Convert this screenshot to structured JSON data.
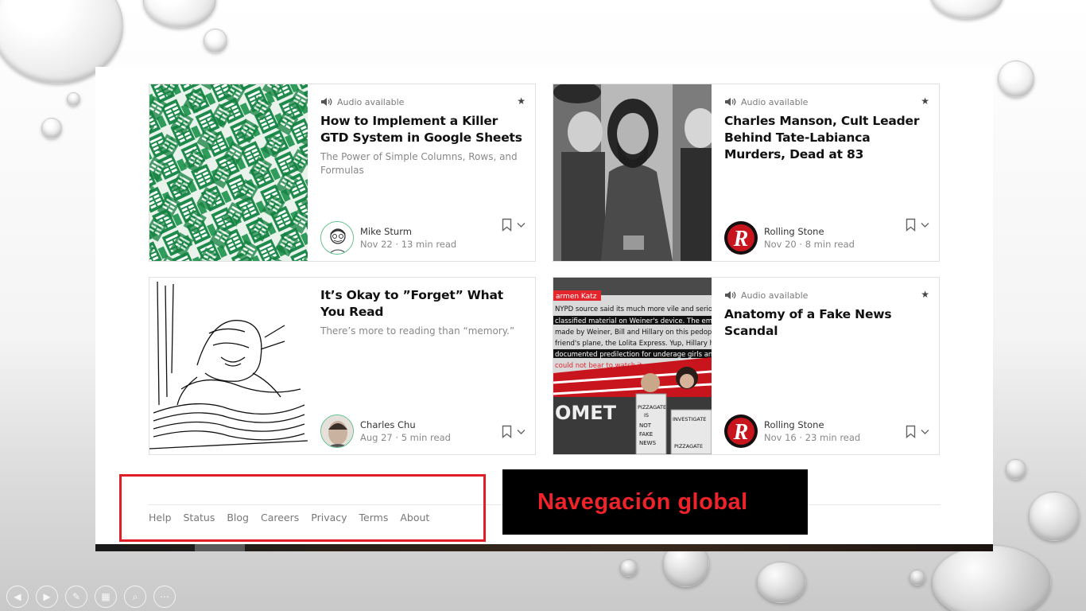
{
  "cards": [
    {
      "audio": "Audio available",
      "title": "How to Implement a Killer GTD System in Google Sheets",
      "subtitle": "The Power of Simple Columns, Rows, and Formulas",
      "author": "Mike Sturm",
      "meta": "Nov 22 · 13 min read"
    },
    {
      "audio": "Audio available",
      "title": "Charles Manson, Cult Leader Behind Tate-Labianca Murders, Dead at 83",
      "subtitle": "",
      "author": "Rolling Stone",
      "meta": "Nov 20 · 8 min read"
    },
    {
      "audio": "",
      "title": "It’s Okay to ”Forget” What You Read",
      "subtitle": "There’s more to reading than “memory.”",
      "author": "Charles Chu",
      "meta": "Aug 27 · 5 min read"
    },
    {
      "audio": "Audio available",
      "title": "Anatomy of a Fake News Scandal",
      "subtitle": "",
      "author": "Rolling Stone",
      "meta": "Nov 16 · 23 min read"
    }
  ],
  "rs_logo_letter": "R",
  "footer": {
    "links": [
      "Help",
      "Status",
      "Blog",
      "Careers",
      "Privacy",
      "Terms",
      "About"
    ]
  },
  "annotation_label": "Navegación global",
  "colors": {
    "highlight": "#e11e26",
    "label_bg": "#000000",
    "label_text": "#f0222a",
    "avatar_ring": "#5cbf8a"
  },
  "news_image_text": {
    "header": "armen Katz",
    "lines": [
      "NYPD source said its much more vile and serious",
      "classified material on Weiner's device. The email DETAIL",
      "made by Weiner, Bill and Hillary on this pedophile isla",
      "friend's plane, the Lolita Express. Yup, Hillary has a wo",
      "documented predilection for underage girls and br",
      "could not bear to watch it"
    ],
    "sign1": "PIZZAGATE IS NOT FAKE NEWS",
    "sign2": "INVESTIGATE PIZZAGATE",
    "banner": "OMET"
  },
  "icons": {
    "audio": "speaker-icon",
    "featured": "star-icon",
    "save": "bookmark-icon",
    "more": "chevron-down-icon",
    "ppt_controls": [
      "prev-icon",
      "next-icon",
      "pen-icon",
      "slides-icon",
      "zoom-icon",
      "more-icon"
    ]
  }
}
